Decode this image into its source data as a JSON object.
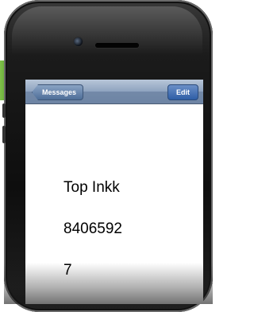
{
  "navbar": {
    "back_label": "Messages",
    "edit_label": "Edit"
  },
  "message": {
    "line1": "Top Inkk",
    "line2": "8406592",
    "line3": "7"
  },
  "colors": {
    "accent_green": "#6db33f",
    "navbar_blue": "#8ea3bf"
  }
}
